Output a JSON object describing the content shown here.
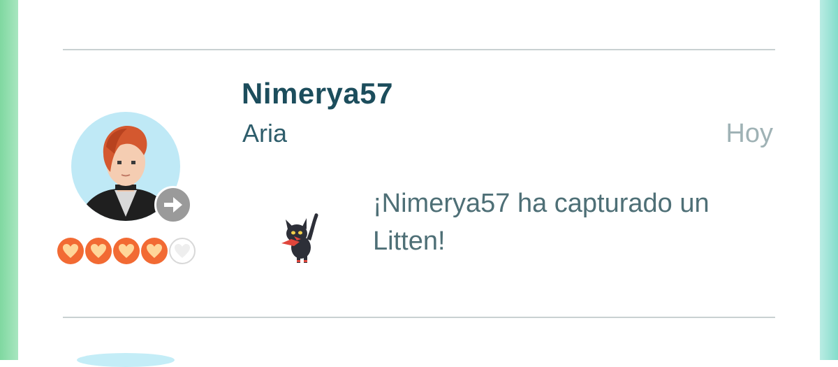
{
  "entry": {
    "username": "Nimerya57",
    "team_name": "Aria",
    "timestamp": "Hoy",
    "message": "¡Nimerya57 ha capturado un Litten!",
    "friendship_level": 4,
    "friendship_max": 5,
    "icons": {
      "avatar": "trainer-avatar-icon",
      "action": "arrow-right-icon",
      "pokemon": "litten-icon",
      "heart": "heart-icon"
    },
    "colors": {
      "username": "#1c4d5c",
      "timestamp": "#9fb2b5",
      "heart_filled": "#f26a33",
      "divider": "#c9d1d2"
    }
  }
}
